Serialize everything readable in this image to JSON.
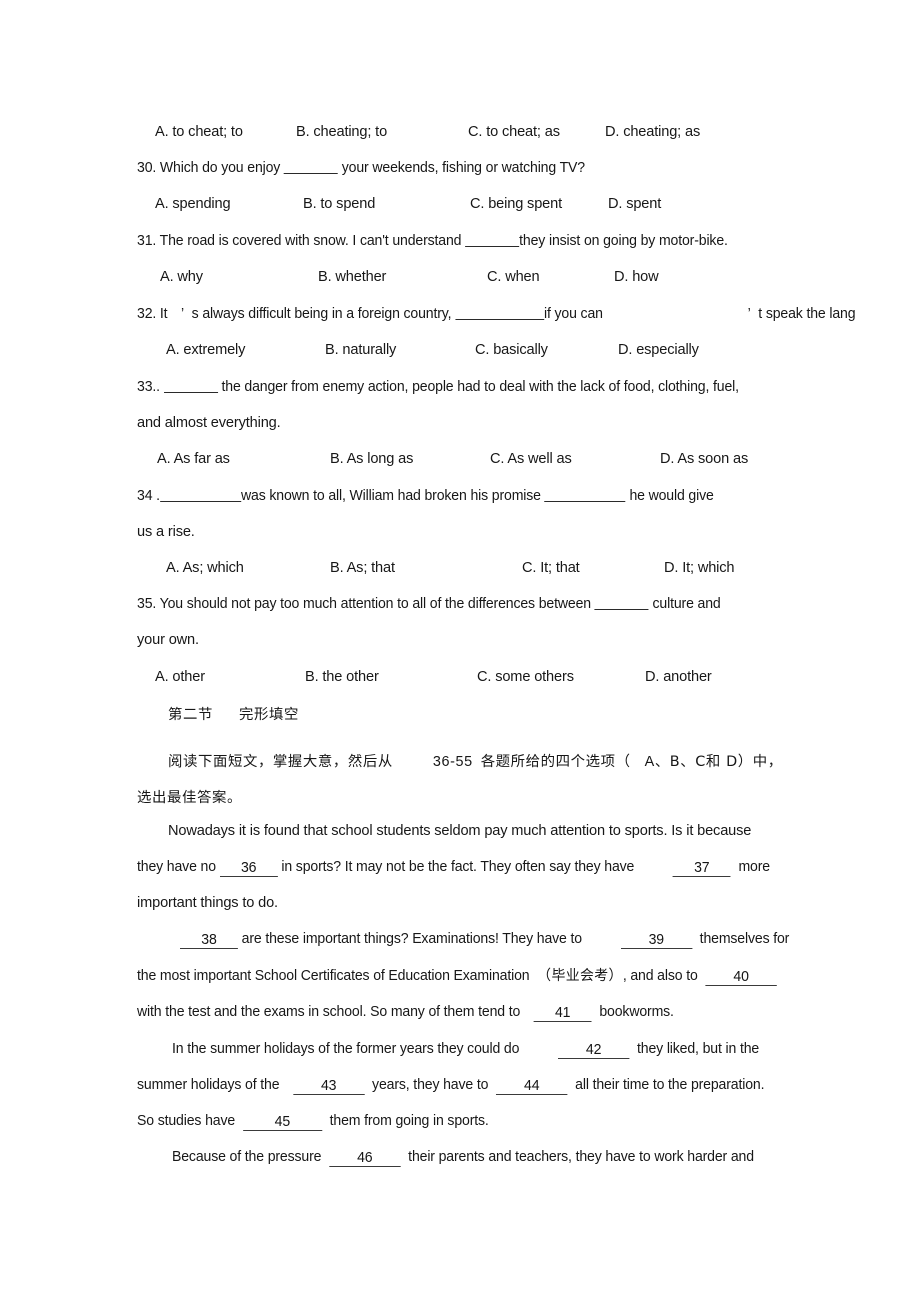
{
  "document": {
    "type": "english-exam-worksheet",
    "page_background": "#ffffff",
    "text_color": "#171717"
  },
  "questions": [
    {
      "id": "q29-options",
      "options": [
        {
          "label": "A. to cheat; to"
        },
        {
          "label": "B. cheating; to"
        },
        {
          "label": "C. to cheat; as"
        },
        {
          "label": "D. cheating; as"
        }
      ]
    },
    {
      "id": "q30",
      "stem_before": "30. Which do you enjoy ",
      "stem_after": " your weekends, fishing or watching TV?",
      "options": [
        {
          "label": "A. spending"
        },
        {
          "label": "B. to spend"
        },
        {
          "label": "C. being spent"
        },
        {
          "label": "D. spent"
        }
      ]
    },
    {
      "id": "q31",
      "stem_before": "31. The road is covered with snow. I can't understand ",
      "stem_after": "they insist on going by motor-bike.",
      "options": [
        {
          "label": "A. why"
        },
        {
          "label": "B. whether"
        },
        {
          "label": "C. when"
        },
        {
          "label": "D. how"
        }
      ]
    },
    {
      "id": "q32",
      "stem_part1": "32. It",
      "stem_apostrophe1": "’",
      "stem_part2": "s always difficult being in a foreign country, ",
      "stem_part3": "if you can",
      "stem_apostrophe2": "’",
      "stem_part4": "t speak the lang",
      "options": [
        {
          "label": "A. extremely"
        },
        {
          "label": "B. naturally"
        },
        {
          "label": "C. basically"
        },
        {
          "label": "D. especially"
        }
      ]
    },
    {
      "id": "q33",
      "stem_before": "33.. ",
      "stem_after": " the danger from enemy action, people had to deal with the lack of food, clothing, fuel,",
      "stem_line2": "and almost everything.",
      "options": [
        {
          "label": "A. As far as"
        },
        {
          "label": "B. As long as"
        },
        {
          "label": "C. As well as"
        },
        {
          "label": "D. As soon as"
        }
      ]
    },
    {
      "id": "q34",
      "stem_before": "34 .",
      "stem_mid": "was known to all, William had broken his promise ",
      "stem_after": " he would give",
      "stem_line2": "us a rise.",
      "options": [
        {
          "label": "A. As; which"
        },
        {
          "label": "B. As; that"
        },
        {
          "label": "C. It; that"
        },
        {
          "label": "D. It; which"
        }
      ]
    },
    {
      "id": "q35",
      "stem_before": "35. You should not pay too much attention to all of the differences between ",
      "stem_after": " culture and",
      "stem_line2": "your own.",
      "options": [
        {
          "label": "A. other"
        },
        {
          "label": "B. the other"
        },
        {
          "label": "C. some others"
        },
        {
          "label": "D. another"
        }
      ]
    }
  ],
  "section": {
    "heading_part1": "第二节",
    "heading_part2": "完形填空",
    "instruction_line1_a": "阅读下面短文，掌握大意，然后从",
    "instruction_line1_b": "36-55",
    "instruction_line1_c": "各题所给的四个选项（",
    "instruction_line1_d": "A",
    "instruction_line1_e": "、B",
    "instruction_line1_f": "、C",
    "instruction_line1_g": "和 D",
    "instruction_line1_h": "）中，",
    "instruction_line2": "选出最佳答案。"
  },
  "passage": {
    "p1_line1": "Nowadays it is found that school students seldom pay much attention to sports. Is it because",
    "p1_line2_a": "they have no ",
    "p1_line2_blank": "36",
    "p1_line2_b": " in sports? It may not be the fact. They often say they have",
    "p1_line2_blank2": "37",
    "p1_line2_c": "more",
    "p1_line3": "important things to do.",
    "p2_line1_blank": "38",
    "p2_line1_a": " are these important things? Examinations! They have to",
    "p2_line1_blank2": "39",
    "p2_line1_b": "themselves for",
    "p2_line2_a": "the most important School Certificates of Education Examination",
    "p2_line2_cn": "（毕业会考）",
    "p2_line2_b": ", and also to",
    "p2_line2_blank": "40",
    "p2_line3_a": "with the test and the exams in school. So many of them tend to",
    "p2_line3_blank": "41",
    "p2_line3_b": "bookworms.",
    "p3_line1_a": "In the summer holidays of the former years they could do",
    "p3_line1_blank": "42",
    "p3_line1_b": "they liked, but in the",
    "p3_line2_a": "summer holidays of the",
    "p3_line2_blank": "43",
    "p3_line2_b": "years, they have to",
    "p3_line2_blank2": "44",
    "p3_line2_c": "all their time to the preparation.",
    "p3_line3_a": "So studies have",
    "p3_line3_blank": "45",
    "p3_line3_b": "them from going in sports.",
    "p4_line1_a": "Because of the pressure",
    "p4_line1_blank": "46",
    "p4_line1_b": "their parents and teachers, they have to work harder and"
  }
}
